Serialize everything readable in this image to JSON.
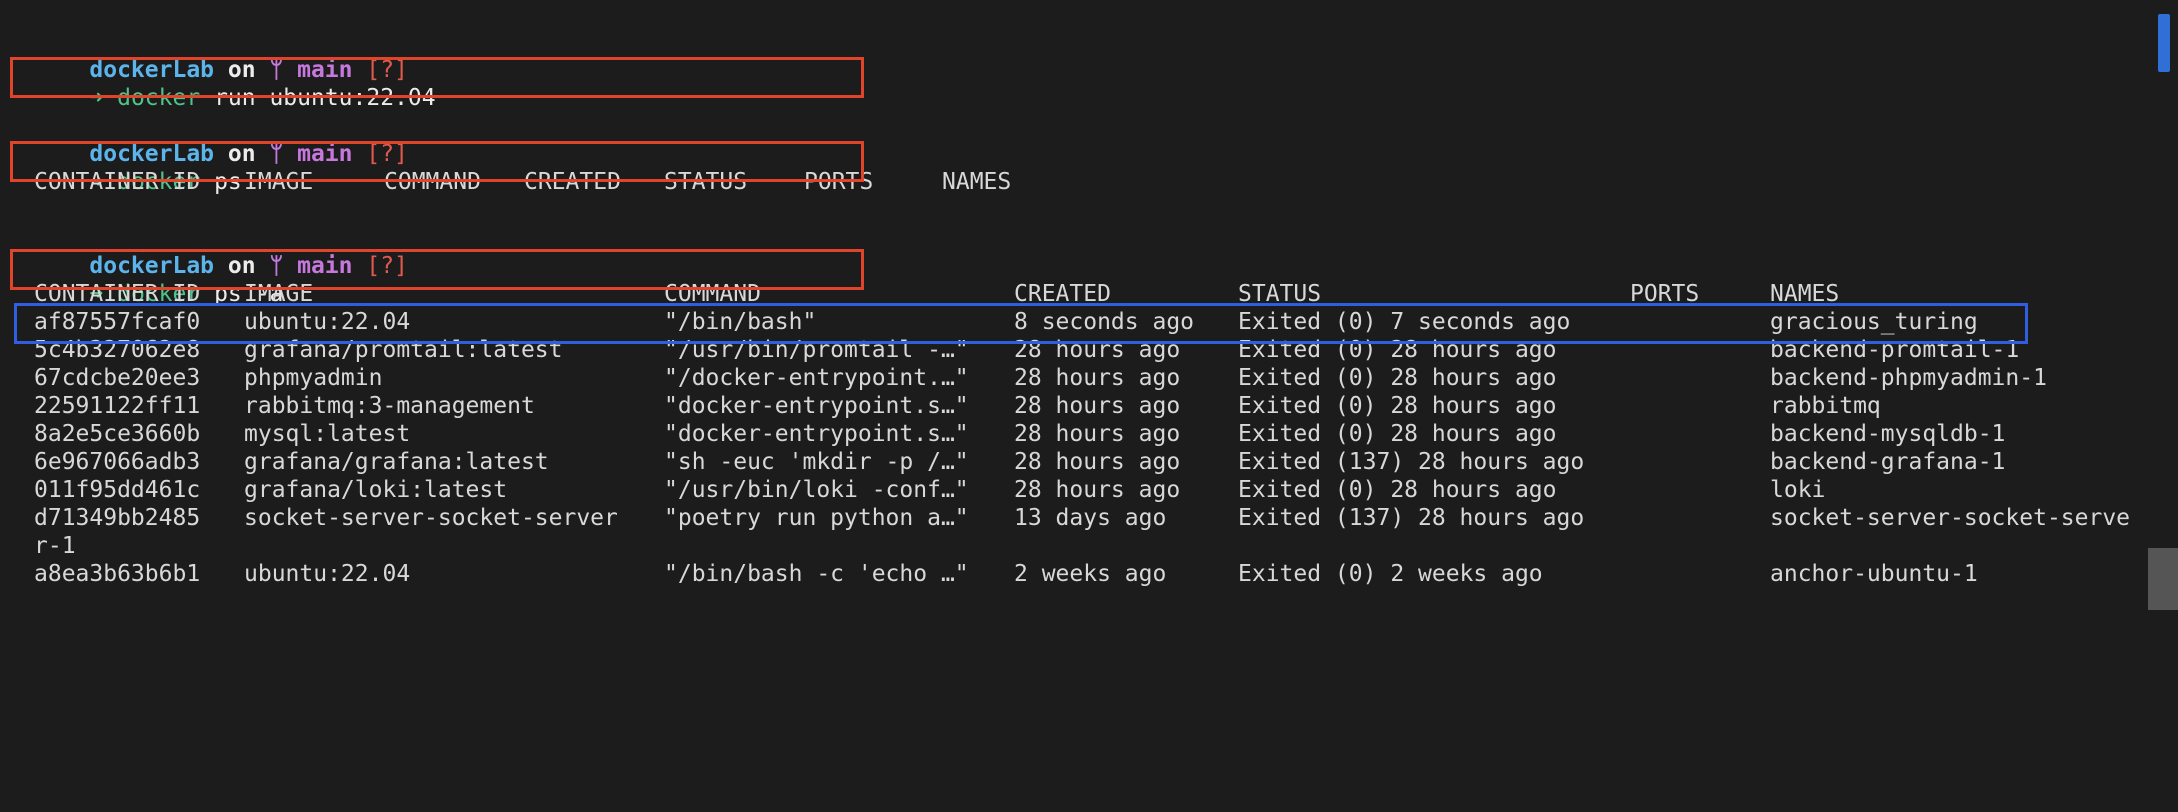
{
  "prompt": {
    "dir": "dockerLab",
    "on": "on",
    "branch_icon": "ᛘ",
    "branch": "main",
    "status": "[?]",
    "arrow": "➜"
  },
  "commands": [
    {
      "name": "docker",
      "args": "run ubuntu:22.04"
    },
    {
      "name": "docker",
      "args": "ps"
    },
    {
      "name": "docker",
      "args": "ps -a"
    }
  ],
  "ps_headers": [
    "CONTAINER ID",
    "IMAGE",
    "COMMAND",
    "CREATED",
    "STATUS",
    "PORTS",
    "NAMES"
  ],
  "ps_a_headers": [
    "CONTAINER ID",
    "IMAGE",
    "COMMAND",
    "CREATED",
    "STATUS",
    "PORTS",
    "NAMES"
  ],
  "containers": [
    {
      "id": "af87557fcaf0",
      "image": "ubuntu:22.04",
      "command": "\"/bin/bash\"",
      "created": "8 seconds ago",
      "status": "Exited (0) 7 seconds ago",
      "ports": "",
      "names": "gracious_turing"
    },
    {
      "id": "5c4b327062e8",
      "image": "grafana/promtail:latest",
      "command": "\"/usr/bin/promtail -…\"",
      "created": "28 hours ago",
      "status": "Exited (0) 28 hours ago",
      "ports": "",
      "names": "backend-promtail-1"
    },
    {
      "id": "67cdcbe20ee3",
      "image": "phpmyadmin",
      "command": "\"/docker-entrypoint.…\"",
      "created": "28 hours ago",
      "status": "Exited (0) 28 hours ago",
      "ports": "",
      "names": "backend-phpmyadmin-1"
    },
    {
      "id": "22591122ff11",
      "image": "rabbitmq:3-management",
      "command": "\"docker-entrypoint.s…\"",
      "created": "28 hours ago",
      "status": "Exited (0) 28 hours ago",
      "ports": "",
      "names": "rabbitmq"
    },
    {
      "id": "8a2e5ce3660b",
      "image": "mysql:latest",
      "command": "\"docker-entrypoint.s…\"",
      "created": "28 hours ago",
      "status": "Exited (0) 28 hours ago",
      "ports": "",
      "names": "backend-mysqldb-1"
    },
    {
      "id": "6e967066adb3",
      "image": "grafana/grafana:latest",
      "command": "\"sh -euc 'mkdir -p /…\"",
      "created": "28 hours ago",
      "status": "Exited (137) 28 hours ago",
      "ports": "",
      "names": "backend-grafana-1"
    },
    {
      "id": "011f95dd461c",
      "image": "grafana/loki:latest",
      "command": "\"/usr/bin/loki -conf…\"",
      "created": "28 hours ago",
      "status": "Exited (0) 28 hours ago",
      "ports": "",
      "names": "loki"
    },
    {
      "id": "d71349bb2485",
      "image": "socket-server-socket-server",
      "command": "\"poetry run python a…\"",
      "created": "13 days ago",
      "status": "Exited (137) 28 hours ago",
      "ports": "",
      "names": "socket-server-socket-serve"
    },
    {
      "id": "",
      "image": "",
      "command": "",
      "created": "",
      "status": "",
      "ports": "",
      "names": "r-1"
    },
    {
      "id": "a8ea3b63b6b1",
      "image": "ubuntu:22.04",
      "command": "\"/bin/bash -c 'echo …\"",
      "created": "2 weeks ago",
      "status": "Exited (0) 2 weeks ago",
      "ports": "",
      "names": "anchor-ubuntu-1"
    }
  ],
  "colors": {
    "background": "#1c1c1c",
    "dir": "#5bb4ec",
    "branch": "#c678dd",
    "status_flag": "#e05a4f",
    "command": "#4fc48a",
    "highlight_red": "#e0452b",
    "highlight_blue": "#2f5fe0"
  }
}
